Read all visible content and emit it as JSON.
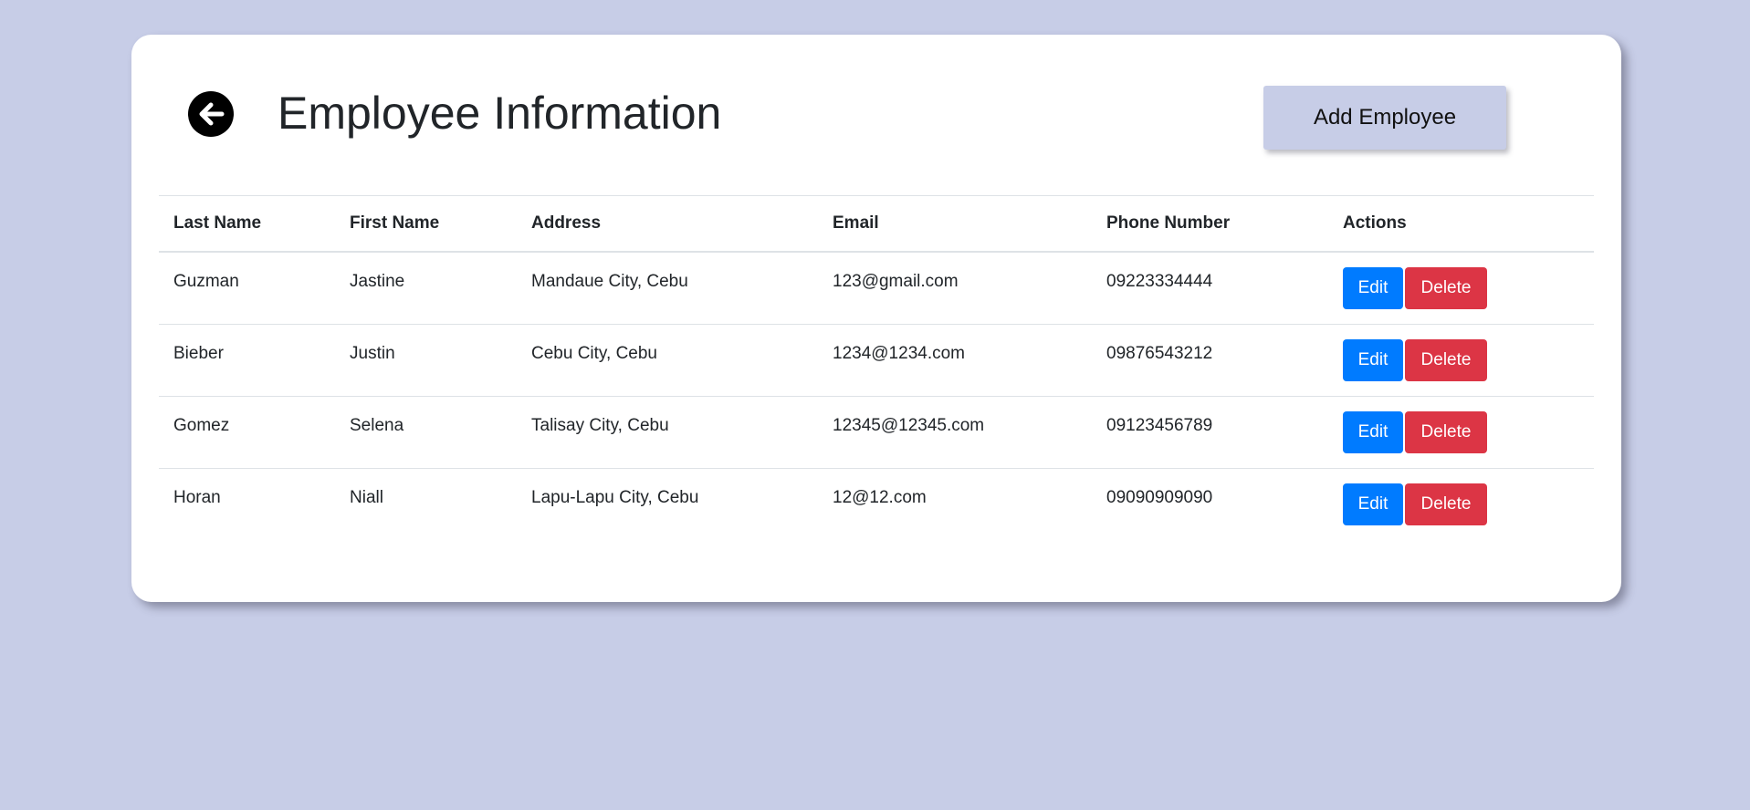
{
  "page": {
    "title": "Employee Information",
    "add_button_label": "Add Employee",
    "background_color": "#c7cde7"
  },
  "table": {
    "headers": {
      "last_name": "Last Name",
      "first_name": "First Name",
      "address": "Address",
      "email": "Email",
      "phone": "Phone Number",
      "actions": "Actions"
    },
    "rows": [
      {
        "last_name": "Guzman",
        "first_name": "Jastine",
        "address": "Mandaue City, Cebu",
        "email": "123@gmail.com",
        "phone": "09223334444"
      },
      {
        "last_name": "Bieber",
        "first_name": "Justin",
        "address": "Cebu City, Cebu",
        "email": "1234@1234.com",
        "phone": "09876543212"
      },
      {
        "last_name": "Gomez",
        "first_name": "Selena",
        "address": "Talisay City, Cebu",
        "email": "12345@12345.com",
        "phone": "09123456789"
      },
      {
        "last_name": "Horan",
        "first_name": "Niall",
        "address": "Lapu-Lapu City, Cebu",
        "email": "12@12.com",
        "phone": "09090909090"
      }
    ],
    "edit_label": "Edit",
    "delete_label": "Delete",
    "edit_color": "#007bff",
    "delete_color": "#dc3545"
  },
  "icons": {
    "back": "arrow-left-circle-icon"
  }
}
